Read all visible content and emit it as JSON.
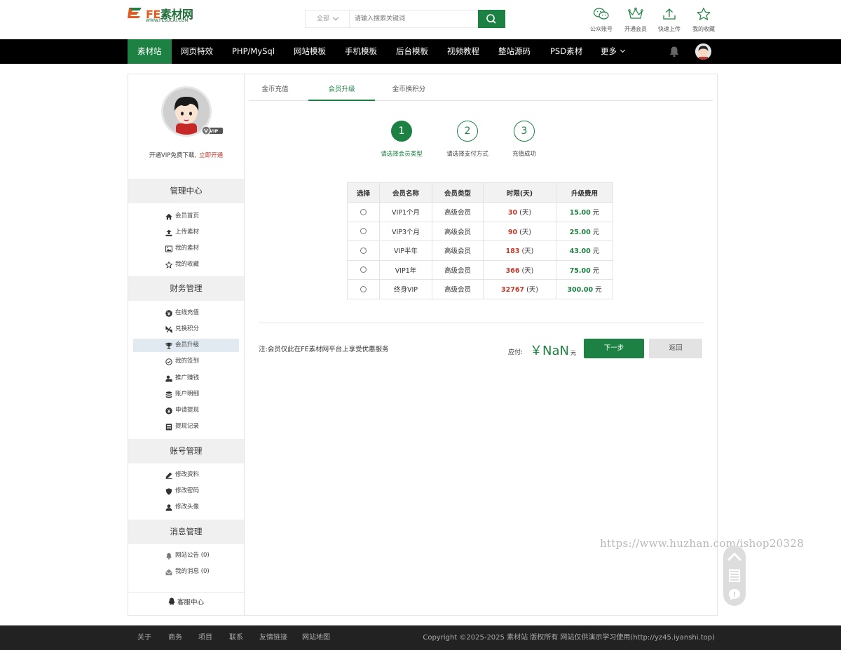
{
  "logo": {
    "brand_fe": "FE",
    "brand_rest": "素材网",
    "url": "WWW.FESUCAI.COM"
  },
  "search": {
    "category": "全部",
    "placeholder": "请输入搜索关键词"
  },
  "tools": [
    {
      "label": "公众账号",
      "icon": "wechat-icon"
    },
    {
      "label": "开通会员",
      "icon": "crown-icon"
    },
    {
      "label": "快速上传",
      "icon": "upload-icon"
    },
    {
      "label": "我的收藏",
      "icon": "star-icon"
    }
  ],
  "nav": {
    "items": [
      "素材站",
      "网页特效",
      "PHP/MySql",
      "网站模板",
      "手机模板",
      "后台模板",
      "视频教程",
      "整站源码",
      "PSD素材"
    ],
    "more": "更多",
    "active_index": 0
  },
  "sidebar": {
    "vip_text": "开通VIP免费下载,",
    "vip_link": "立即开通",
    "vip_badge": "VIP",
    "sections": [
      {
        "title": "管理中心",
        "items": [
          {
            "label": "会员首页",
            "icon": "home-icon"
          },
          {
            "label": "上传素材",
            "icon": "upload-icon"
          },
          {
            "label": "我的素材",
            "icon": "image-icon"
          },
          {
            "label": "我的收藏",
            "icon": "star-icon"
          }
        ]
      },
      {
        "title": "财务管理",
        "items": [
          {
            "label": "在线充值",
            "icon": "yen-icon"
          },
          {
            "label": "兑换积分",
            "icon": "exchange-icon"
          },
          {
            "label": "会员升级",
            "icon": "trophy-icon",
            "active": true
          },
          {
            "label": "我的签到",
            "icon": "check-circle-icon"
          },
          {
            "label": "推广赚钱",
            "icon": "user-money-icon"
          },
          {
            "label": "账户明细",
            "icon": "database-icon"
          },
          {
            "label": "申请提现",
            "icon": "yen-icon"
          },
          {
            "label": "提现记录",
            "icon": "record-icon"
          }
        ]
      },
      {
        "title": "账号管理",
        "items": [
          {
            "label": "修改资料",
            "icon": "edit-icon"
          },
          {
            "label": "修改密码",
            "icon": "shield-icon"
          },
          {
            "label": "修改头像",
            "icon": "user-icon"
          }
        ]
      },
      {
        "title": "消息管理",
        "items": [
          {
            "label": "网站公告 (0)",
            "icon": "bell-icon"
          },
          {
            "label": "我的消息 (0)",
            "icon": "mail-icon"
          }
        ]
      }
    ],
    "service": "客服中心"
  },
  "tabs": [
    "金币充值",
    "会员升级",
    "金币换积分"
  ],
  "active_tab": 1,
  "steps": [
    {
      "num": "1",
      "label": "请选择会员类型"
    },
    {
      "num": "2",
      "label": "请选择支付方式"
    },
    {
      "num": "3",
      "label": "充值成功"
    }
  ],
  "active_step": 0,
  "table": {
    "headers": [
      "选择",
      "会员名称",
      "会员类型",
      "时限(天)",
      "升级费用"
    ],
    "rows": [
      {
        "name": "VIP1个月",
        "type": "高级会员",
        "days": "30",
        "price": "15.00"
      },
      {
        "name": "VIP3个月",
        "type": "高级会员",
        "days": "90",
        "price": "25.00"
      },
      {
        "name": "VIP半年",
        "type": "高级会员",
        "days": "183",
        "price": "43.00"
      },
      {
        "name": "VIP1年",
        "type": "高级会员",
        "days": "366",
        "price": "75.00"
      },
      {
        "name": "终身VIP",
        "type": "高级会员",
        "days": "32767",
        "price": "300.00"
      }
    ],
    "day_unit": "(天)",
    "price_unit": "元"
  },
  "note": "注:会员仅此在FE素材网平台上享受优惠服务",
  "due": {
    "label": "应付:",
    "value": "￥NaN",
    "unit": "元"
  },
  "buttons": {
    "next": "下一步",
    "back": "返回"
  },
  "watermark": "https://www.huzhan.com/ishop20328",
  "footer": {
    "links": [
      "关于",
      "商务",
      "项目",
      "联系",
      "友情链接",
      "网站地图"
    ],
    "copyright": "Copyright ©2025-2025 素材站 版权所有 网站仅供演示学习使用(http://yz45.iyanshi.top)"
  },
  "colors": {
    "primary": "#1d8143",
    "price": "#1d8143",
    "days": "#c0392b",
    "nav_bg": "#000000",
    "footer_bg": "#222222"
  }
}
